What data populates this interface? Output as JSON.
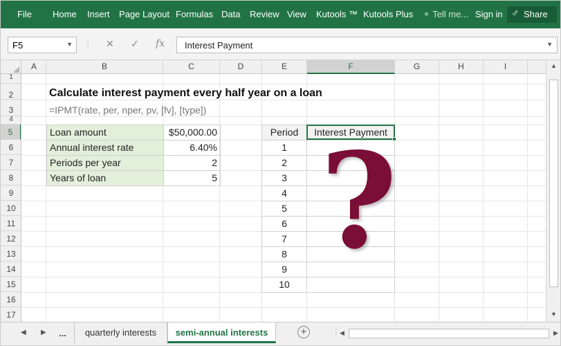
{
  "ribbon": {
    "tabs": [
      "File",
      "Home",
      "Insert",
      "Page Layout",
      "Formulas",
      "Data",
      "Review",
      "View",
      "Kutools ™",
      "Kutools Plus"
    ],
    "tell_me": "Tell me...",
    "sign_in": "Sign in",
    "share": "Share"
  },
  "formula_bar": {
    "name_box": "F5",
    "formula": "Interest Payment"
  },
  "columns": [
    "A",
    "B",
    "C",
    "D",
    "E",
    "F",
    "G",
    "H",
    "I"
  ],
  "rows": [
    "1",
    "2",
    "3",
    "4",
    "5",
    "6",
    "7",
    "8",
    "9",
    "10",
    "11",
    "12",
    "13",
    "14",
    "15",
    "16",
    "17"
  ],
  "sheet": {
    "title": "Calculate interest payment every half year on a loan",
    "syntax": "=IPMT(rate, per, nper, pv, [fv], [type])",
    "loan_table": [
      {
        "label": "Loan amount",
        "value": "$50,000.00"
      },
      {
        "label": "Annual interest rate",
        "value": "6.40%"
      },
      {
        "label": "Periods per year",
        "value": "2"
      },
      {
        "label": "Years of loan",
        "value": "5"
      }
    ],
    "schedule": {
      "header_period": "Period",
      "header_payment": "Interest Payment",
      "periods": [
        "1",
        "2",
        "3",
        "4",
        "5",
        "6",
        "7",
        "8",
        "9",
        "10"
      ]
    },
    "placeholder": "?"
  },
  "sheet_tabs": {
    "more": "...",
    "tabs": [
      "quarterly interests",
      "semi-annual interests"
    ],
    "active": "semi-annual interests"
  },
  "colors": {
    "excel_green": "#217346",
    "input_fill": "#e2efda",
    "question_mark": "#7b0e36"
  }
}
